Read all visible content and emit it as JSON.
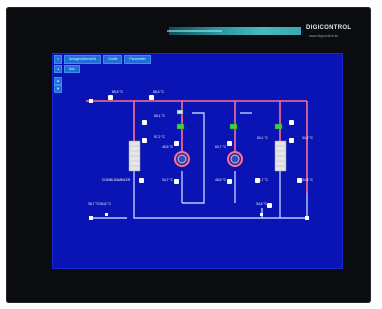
{
  "brand": {
    "name": "DIGICONTROL",
    "subtitle": "www.digicontrol.de"
  },
  "toolbar": {
    "home_label": "≡",
    "main_tab": "Anlagenübersicht",
    "tab2": "Grafik",
    "tab3": "Parameter",
    "sub_tab1": "◂",
    "sub_tab2": "Info"
  },
  "side_buttons": [
    "▲",
    "▼"
  ],
  "sensors": {
    "supply_left": "89,5 °C",
    "supply_mid": "88,6 °C",
    "boiler1_temp": "65,1 °C",
    "boiler1_return": "57,2 °C",
    "combiner_label": "COMBI-SAMMLER",
    "hx_bottom_left": "34,7 °C",
    "hx_bottom_left2": "34,2 °C",
    "pump_mid_top": "48,5 °C",
    "pump_mid_bottom": "45,5 °C",
    "hx_right_top": "60,7 °C",
    "hx_right_bottom": "46,7 °C",
    "right_top": "60,1 °C",
    "right_bottom": "34,8 °C",
    "return_left": "35,7 °C/34,8 °C",
    "return_right": "34,8 °C"
  },
  "colors": {
    "screen_bg": "#0a14b4",
    "supply_pipe": "#ff6f8f",
    "return_pipe": "#b9c9ff",
    "valve": "#3fd43f"
  }
}
